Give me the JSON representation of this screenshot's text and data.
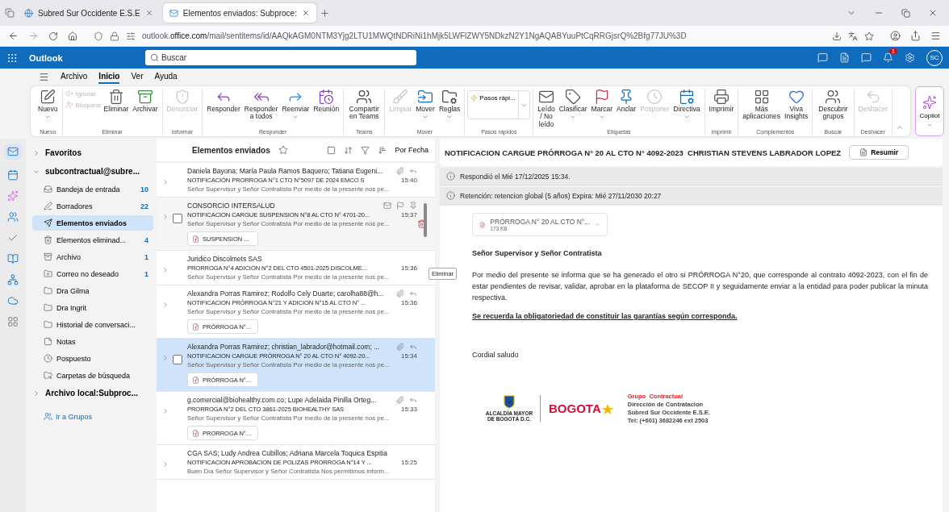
{
  "browser": {
    "tabs": [
      {
        "title": "Subred Sur Occidente E.S.E",
        "selected": false
      },
      {
        "title": "Elementos enviados: Subproce:",
        "selected": true
      }
    ],
    "url": "outlook.**office.com**/mail/sentitems/id/AAQkAGM0NTM3Yjg2LTU1MWQtNDRiNi1hMjk5LWFlZWY5NDkzN2Y1NgAQABYuuPtCqRRGjsrQ%2Bfg77JU%3D"
  },
  "app": {
    "name": "Outlook",
    "search_placeholder": "Buscar",
    "avatar": "SC",
    "notification_count": "1"
  },
  "ribbon_tabs": [
    {
      "label": "Archivo",
      "selected": false
    },
    {
      "label": "Inicio",
      "selected": true
    },
    {
      "label": "Ver",
      "selected": false
    },
    {
      "label": "Ayuda",
      "selected": false
    }
  ],
  "ribbon_groups": [
    {
      "label": "Nuevo",
      "buttons": [
        {
          "label": "Nuevo",
          "caret": true,
          "disabled": false
        }
      ]
    },
    {
      "label": "Eliminar",
      "small_buttons": [
        {
          "label": "Ignorar",
          "disabled": true
        },
        {
          "label": "Bloquear",
          "disabled": true
        }
      ],
      "buttons": [
        {
          "label": "Eliminar",
          "caret": false,
          "disabled": false
        },
        {
          "label": "Archivar",
          "caret": false,
          "disabled": false
        }
      ]
    },
    {
      "label": "Informar",
      "buttons": [
        {
          "label": "Denunciar",
          "caret": true,
          "disabled": true
        }
      ]
    },
    {
      "label": "Responder",
      "buttons": [
        {
          "label": "Responder",
          "caret": false,
          "disabled": false
        },
        {
          "label": "Responder a todos",
          "caret": false,
          "disabled": false
        },
        {
          "label": "Reenviar",
          "caret": true,
          "disabled": false
        },
        {
          "label": "Reunión",
          "caret": false,
          "disabled": false
        }
      ]
    },
    {
      "label": "Teams",
      "buttons": [
        {
          "label": "Compartir en Teams",
          "caret": false,
          "disabled": false
        }
      ]
    },
    {
      "label": "Mover",
      "buttons": [
        {
          "label": "Limpiar",
          "caret": false,
          "disabled": true
        },
        {
          "label": "Mover",
          "caret": true,
          "disabled": false
        },
        {
          "label": "Reglas",
          "caret": true,
          "disabled": false
        }
      ]
    },
    {
      "label": "Pasos rápidos",
      "quick_step": "Pasos rápi..."
    },
    {
      "label": "Etiquetas",
      "buttons": [
        {
          "label": "Leído / No leído",
          "caret": false,
          "disabled": false
        },
        {
          "label": "Clasificar",
          "caret": true,
          "disabled": false
        },
        {
          "label": "Marcar",
          "caret": true,
          "disabled": false
        },
        {
          "label": "Anclar",
          "caret": false,
          "disabled": false
        },
        {
          "label": "Posponer",
          "caret": true,
          "disabled": true
        },
        {
          "label": "Directiva",
          "caret": true,
          "disabled": false
        }
      ]
    },
    {
      "label": "Imprimir",
      "buttons": [
        {
          "label": "Imprimir",
          "caret": false,
          "disabled": false
        }
      ]
    },
    {
      "label": "Complementos",
      "buttons": [
        {
          "label": "Más aplicaciones",
          "caret": false,
          "disabled": false
        },
        {
          "label": "Viva Insights",
          "caret": false,
          "disabled": false
        }
      ]
    },
    {
      "label": "Buscar",
      "buttons": [
        {
          "label": "Descubrir grupos",
          "caret": false,
          "disabled": false
        }
      ]
    },
    {
      "label": "Deshacer",
      "buttons": [
        {
          "label": "Deshacer",
          "caret": false,
          "disabled": true
        }
      ]
    }
  ],
  "copilot": {
    "label": "Copilot"
  },
  "nav": {
    "sections": [
      {
        "label": "Favoritos",
        "expanded": false
      },
      {
        "label": "subcontractual@subre...",
        "expanded": true,
        "folders": [
          {
            "name": "Bandeja de entrada",
            "count": "10",
            "selected": false
          },
          {
            "name": "Borradores",
            "count": "22",
            "selected": false
          },
          {
            "name": "Elementos enviados",
            "selected": true
          },
          {
            "name": "Elementos eliminad...",
            "count": "4",
            "selected": false
          },
          {
            "name": "Archivo",
            "count": "1",
            "selected": false
          },
          {
            "name": "Correo no deseado",
            "count": "1",
            "selected": false
          },
          {
            "name": "Dra Gilma",
            "selected": false
          },
          {
            "name": "Dra Ingrit",
            "selected": false
          },
          {
            "name": "Historial de conversaci...",
            "selected": false
          },
          {
            "name": "Notas",
            "selected": false
          },
          {
            "name": "Pospuesto",
            "selected": false
          },
          {
            "name": "Carpetas de búsqueda",
            "selected": false
          }
        ]
      },
      {
        "label": "Archivo local:Subproc...",
        "expanded": false
      }
    ],
    "groups_link": "Ir a Grupos"
  },
  "mail_list": {
    "title": "Elementos enviados",
    "sort": "Por Fecha",
    "messages": [
      {
        "from": "Daniela Bayona; María Paula Ramos Baquero; Tatiana Eugeni...",
        "subject": "NOTIFICACIÓN PRORROGA N°1 CTO N°5097 DE 2024 EMCO S",
        "time": "15:40",
        "preview": "Señor Supervisor y Señor Contratista Por medio de la presente nos pe...",
        "attachment": true,
        "replied": true,
        "hovered": false,
        "selected": false
      },
      {
        "from": "CONSORCIO INTERSALUD",
        "subject": "NOTIFICACION CARGUE SUSPENSION N°8 AL CTO N° 4701-20...",
        "time": "15:37",
        "preview": "Señor Supervisor y Señor Contratista Por medio de la presente nos pe...",
        "attachment": false,
        "replied": false,
        "hovered": true,
        "selected": false,
        "file": "SUSPENSION ..."
      },
      {
        "from": "Juridico Discolmets SAS",
        "subject": "PRORROGA N°4 ADICION N°2 DEL CTO 4501-2025 DISCOLME...",
        "time": "15:36",
        "preview": "Señor Supervisor y Señor Contratista Por medio de la presente nos pe...",
        "attachment": false,
        "replied": false,
        "hovered": false,
        "selected": false
      },
      {
        "from": "Alexandra Porras Ramirez; Rodolfo Cely Duarte; carolha88@h...",
        "subject": "NOTIFICACION PRÓRROGA N°21 Y ADICION N°15 AL CTO N° ...",
        "time": "15:36",
        "preview": "Señor Supervisor y Señor Contratista Por medio de la presente nos pe...",
        "attachment": true,
        "replied": true,
        "hovered": false,
        "selected": false,
        "file": "PRÓRROGA N°..."
      },
      {
        "from": "Alexandra Porras Ramirez; christian_labrador@hotmail.com; ...",
        "subject": "NOTIFICACION CARGUE PRÓRROGA N° 20 AL CTO N° 4092-20...",
        "time": "15:34",
        "preview": "Señor Supervisor y Señor Contratista Por medio de la presente nos pe...",
        "attachment": true,
        "replied": true,
        "hovered": false,
        "selected": true,
        "file": "PRÓRROGA N°..."
      },
      {
        "from": "g.comercial@biohealthy.com.co; Lupe Adelaida Pinilla Orteg...",
        "subject": "PRORROGA N°2 DEL CTO 3861-2025 BIOHEALTHY SAS",
        "time": "15:33",
        "preview": "Señor Supervisor y Señor Contratista Por medio de la presente nos pe...",
        "attachment": true,
        "replied": true,
        "hovered": false,
        "selected": false,
        "file": "PRORROGA N°..."
      },
      {
        "from": "CGA SAS; Ludy Andrea Cubillos; Adriana Marcela Toquica Espitia",
        "subject": "NOTIFICACION APROBACION DE POLIZAS PRORROGA N°14 Y ...",
        "time": "15:25",
        "preview": "Buen Día Señor Supervisor y Señor Contratista Nos permitimos inform...",
        "attachment": false,
        "replied": false,
        "hovered": false,
        "selected": false
      }
    ]
  },
  "tooltip": "Eliminar",
  "reading": {
    "subject": "NOTIFICACION CARGUE PRÓRROGA N° 20 AL CTO N° 4092-2023  CHRISTIAN STEVENS LABRADOR LOPEZ",
    "summarize": "Resumir",
    "notices": [
      "Respondió el Mié 17/12/2025 15:34.",
      "Retención: retencion global (5 años) Expira: Mié 27/11/2030 20:27"
    ],
    "attachment": {
      "name": "PRÓRROGA N° 20 AL CTO N°...",
      "size": "173 KB"
    },
    "greeting": "Señor Supervisor y Señor Contratista",
    "paragraph": "Por medio del presente se informa que se ha generado el otro si PRÓRROGA N°20, que corresponde al contrato 4092-2023, con el fin de estar pendientes de revisar, validar, aprobar en la plataforma de SECOP II y seguidamente enviar a la entidad para poder publicar la minuta respectiva.",
    "reminder": "Se recuerda la obligatoriedad de constituir las garantías según corresponda.",
    "closing": "Cordial saludo",
    "signature": {
      "logo_caption": "ALCALDÍA MAYOR DE BOGOTÁ D.C.",
      "logo_word": "BOGOTA",
      "group": "Grupo  Contractual",
      "lines": [
        "Dirección de Contratacion",
        "Subred Sur Occidente E.S.E.",
        "Tel: (+601)  3682246  ext 2503"
      ]
    }
  }
}
